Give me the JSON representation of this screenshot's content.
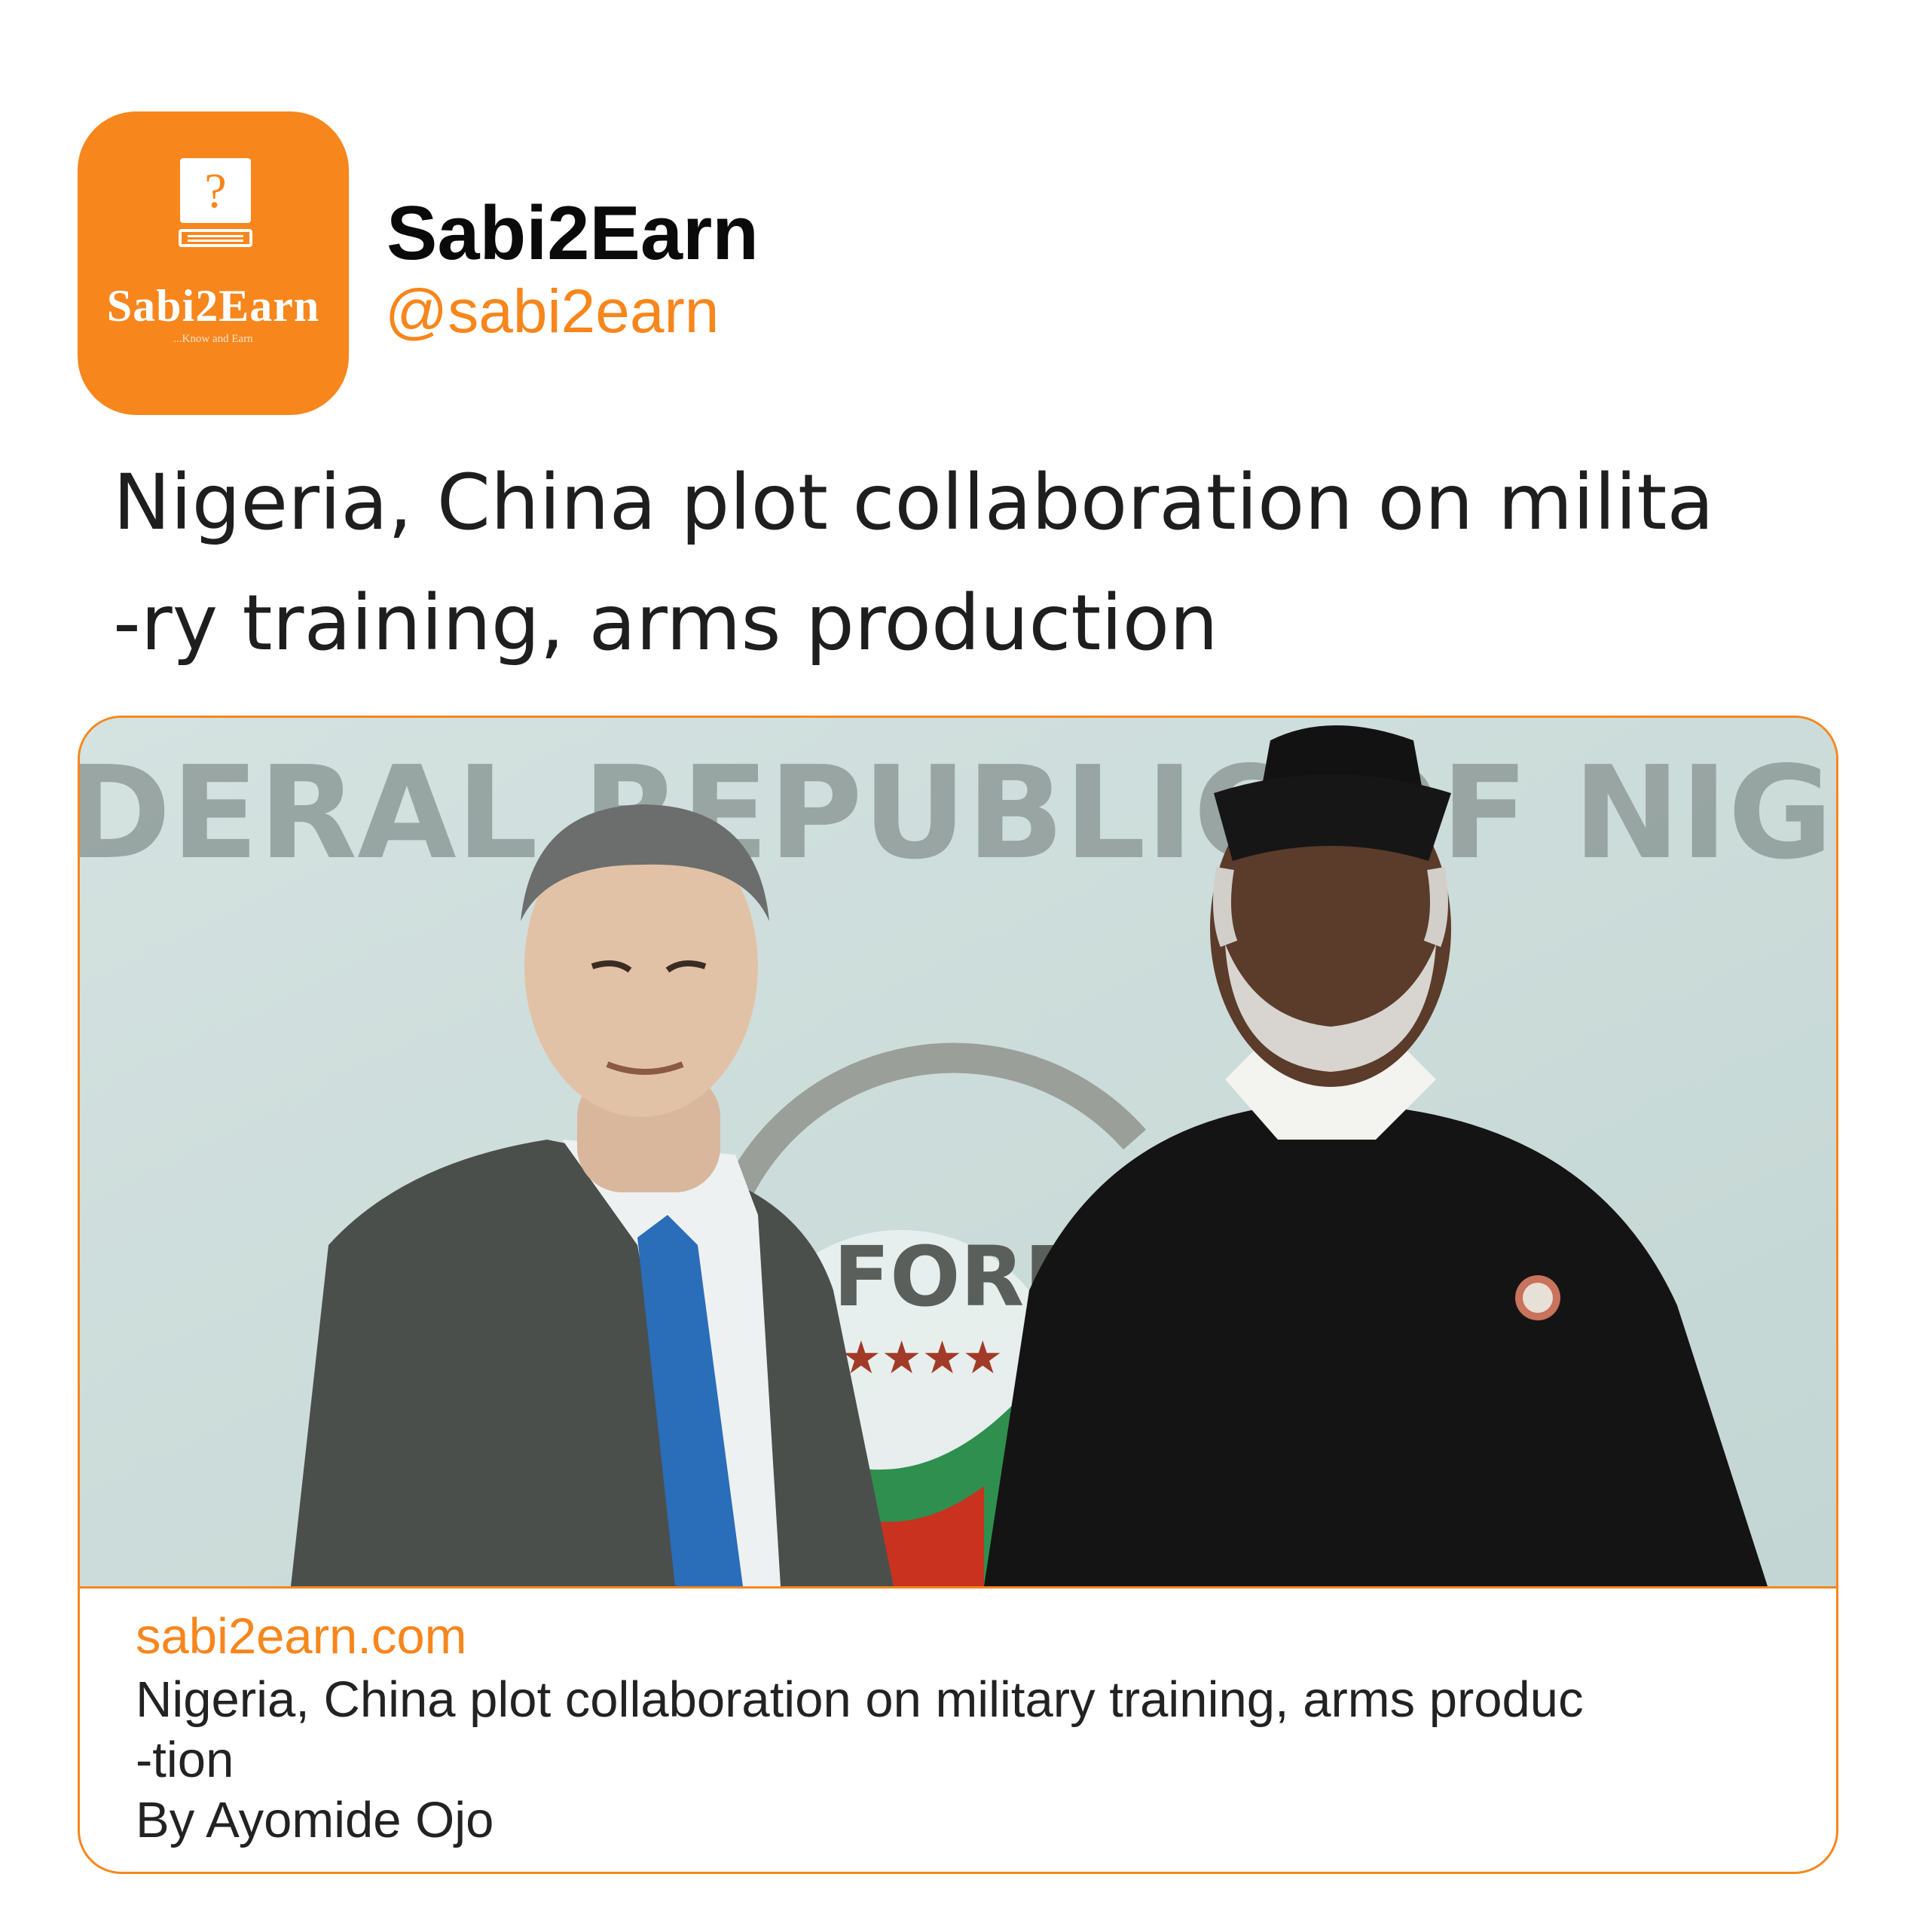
{
  "account": {
    "name": "Sabi2Earn",
    "handle": "@sabi2earn",
    "logo_text": "Sabi2Earn",
    "logo_tagline": "...Know and Earn",
    "logo_glyph": "?"
  },
  "post": {
    "headline_lines": [
      "Nigeria, China plot collaboration on milita",
      "-ry training, arms production"
    ]
  },
  "card": {
    "image_sign_text": "DERAL REPUBLIC OF NIGE",
    "image_emblem_text": "FORE",
    "domain": "sabi2earn.com",
    "title_lines": [
      "Nigeria, China plot collaboration on military training, arms produc",
      "-tion"
    ],
    "byline": "By Ayomide Ojo"
  },
  "colors": {
    "brand_orange": "#f7861c",
    "text_dark": "#1e1e1e",
    "background": "#ffffff"
  }
}
